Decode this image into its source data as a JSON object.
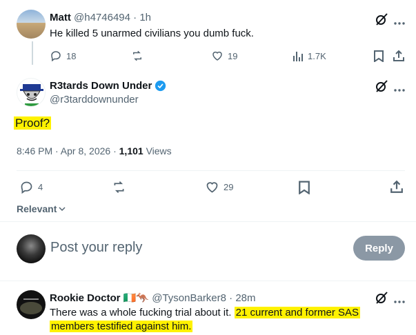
{
  "tweet1": {
    "name": "Matt",
    "handle": "@h4746494",
    "time": "1h",
    "text": "He killed 5 unarmed civilians you dumb fuck.",
    "replies": "18",
    "likes": "19",
    "views": "1.7K"
  },
  "tweet2": {
    "name": "R3tards Down Under",
    "handle": "@r3tarddownunder",
    "text": "Proof?",
    "time": "8:46 PM · Apr 8, 2026 · ",
    "views_count": "1,101",
    "views_label": " Views",
    "replies": "4",
    "likes": "29"
  },
  "relevant_label": "Relevant",
  "compose": {
    "placeholder": "Post your reply",
    "button": "Reply"
  },
  "tweet3": {
    "name": "Rookie Doctor",
    "flags": "🇮🇪🦘",
    "handle": "@TysonBarker8",
    "time": "28m",
    "text_plain": "There was a whole fucking trial about it. ",
    "text_hl1": "21 current and former SAS",
    "text_hl2": "members testified against him."
  },
  "colors": {
    "verified": "#1d9bf0",
    "highlight": "#fff200",
    "reply_button": "#8b98a5"
  },
  "icons": [
    "reply-icon",
    "retweet-icon",
    "like-icon",
    "views-icon",
    "bookmark-icon",
    "share-icon",
    "grok-icon",
    "more-icon",
    "verified-icon",
    "chevron-down-icon"
  ]
}
